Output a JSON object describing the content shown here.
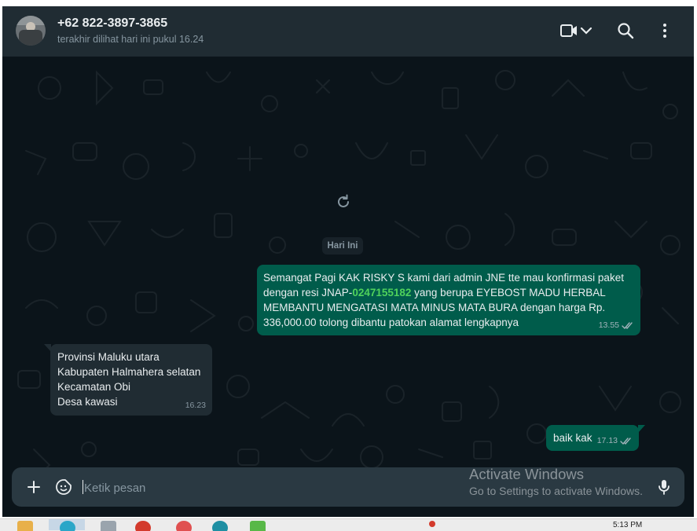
{
  "header": {
    "contact_name": "+62 822-3897-3865",
    "last_seen": "terakhir dilihat hari ini pukul 16.24",
    "icons": [
      "video-call-icon",
      "chevron-down-icon",
      "search-icon",
      "menu-dots-icon"
    ]
  },
  "chat": {
    "day_label": "Hari Ini",
    "messages": [
      {
        "direction": "out",
        "text_before": "Semangat Pagi KAK RISKY S kami dari admin JNE tte mau konfirmasi paket\ndengan resi JNAP-",
        "highlight": "0247155182",
        "text_after": " yang berupa EYEBOST MADU HERBAL\nMEMBANTU MENGATASI MATA MINUS MATA BURA dengan harga Rp.\n336,000.00 tolong dibantu patokan alamat lengkapnya",
        "time": "13.55",
        "status": "read"
      },
      {
        "direction": "in",
        "text": "Provinsi Maluku utara\nKabupaten Halmahera selatan\nKecamatan Obi\nDesa kawasi",
        "time": "16.23"
      },
      {
        "direction": "out",
        "text": "baik kak",
        "time": "17.13",
        "status": "read"
      }
    ]
  },
  "composer": {
    "placeholder": "Ketik pesan"
  },
  "watermark": {
    "title": "Activate Windows",
    "subtitle": "Go to Settings to activate Windows."
  },
  "taskbar": {
    "clock": "5:13 PM"
  },
  "colors": {
    "app_bg": "#0b141a",
    "header_bg": "#202c33",
    "outgoing_bubble": "#005c4b",
    "incoming_bubble": "#202c33",
    "link_green": "#4fd25b",
    "read_ticks": "#a3b3bb"
  }
}
